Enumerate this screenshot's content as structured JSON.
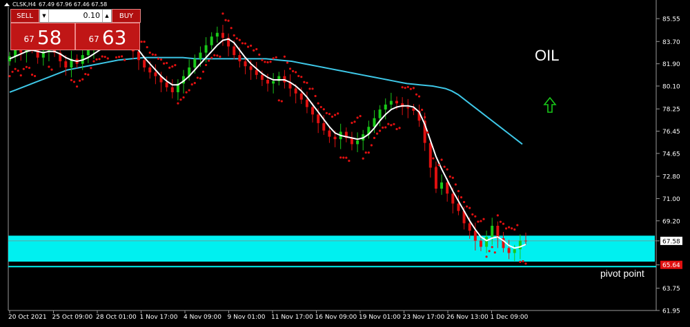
{
  "header": {
    "symbol": "CLSK,H4",
    "ohlc": "67.49 67.96 67.46 67.58"
  },
  "trade_panel": {
    "sell_label": "SELL",
    "buy_label": "BUY",
    "lot_value": "0.10",
    "sell_price_small": "67",
    "sell_price_big": "58",
    "buy_price_small": "67",
    "buy_price_big": "63"
  },
  "annotations": {
    "title": "OIL",
    "pivot_label": "pivot point",
    "arrow": "up-arrow-icon",
    "arrow_color": "#19c919"
  },
  "colors": {
    "background": "#000000",
    "bull": "#19c919",
    "bear": "#e01010",
    "sar": "#e01010",
    "ma_fast": "#ffffff",
    "ma_slow": "#3ec8e8",
    "zone": "#00f0f0",
    "current_price_tag": "#ffffff",
    "pivot_tag": "#e01010"
  },
  "chart_data": {
    "type": "candlestick",
    "timeframe": "H4",
    "ylim": [
      61.95,
      86.5
    ],
    "y_ticks": [
      "85.55",
      "83.70",
      "81.90",
      "80.10",
      "78.25",
      "76.45",
      "74.65",
      "72.80",
      "71.00",
      "69.20",
      "67.58",
      "65.64",
      "63.75",
      "61.95"
    ],
    "x_ticks": [
      "20 Oct 2021",
      "25 Oct 09:00",
      "28 Oct 01:00",
      "1 Nov 17:00",
      "4 Nov 09:00",
      "9 Nov 01:00",
      "11 Nov 17:00",
      "16 Nov 09:00",
      "19 Nov 01:00",
      "23 Nov 17:00",
      "26 Nov 13:00",
      "1 Dec 09:00"
    ],
    "current_price": 67.58,
    "pivot_price": 65.64,
    "zone": [
      65.9,
      68.0
    ],
    "zone_line": 65.5,
    "closes": [
      82.5,
      83.2,
      82.8,
      83.6,
      83.1,
      82.4,
      82.9,
      83.5,
      82.8,
      82.1,
      81.6,
      82.3,
      81.9,
      82.6,
      83.1,
      83.7,
      84.0,
      84.3,
      83.8,
      84.5,
      84.1,
      83.5,
      82.9,
      82.2,
      81.6,
      81.2,
      80.9,
      80.4,
      80.0,
      79.6,
      80.3,
      80.9,
      81.6,
      82.3,
      82.8,
      83.4,
      84.1,
      84.4,
      84.0,
      83.3,
      82.6,
      82.1,
      81.7,
      81.4,
      81.0,
      80.6,
      80.3,
      80.5,
      80.9,
      80.4,
      79.9,
      79.5,
      79.0,
      78.4,
      77.8,
      77.1,
      76.5,
      76.0,
      75.8,
      76.4,
      75.9,
      75.4,
      75.7,
      76.2,
      76.8,
      77.5,
      78.2,
      78.6,
      78.9,
      78.7,
      78.4,
      78.3,
      78.1,
      77.3,
      75.5,
      73.5,
      71.8,
      72.3,
      71.4,
      70.6,
      70.0,
      69.0,
      68.4,
      67.6,
      67.1,
      67.9,
      68.8,
      67.8,
      67.0,
      66.6,
      66.9,
      67.6,
      67.58
    ],
    "ma_fast": [
      82.3,
      82.5,
      82.7,
      82.9,
      83.0,
      82.9,
      82.8,
      82.9,
      82.9,
      82.7,
      82.4,
      82.2,
      82.1,
      82.2,
      82.4,
      82.7,
      83.0,
      83.3,
      83.6,
      83.9,
      84.0,
      83.9,
      83.5,
      83.0,
      82.4,
      81.9,
      81.4,
      80.9,
      80.5,
      80.2,
      80.2,
      80.5,
      80.9,
      81.4,
      81.9,
      82.4,
      82.9,
      83.4,
      83.8,
      83.9,
      83.6,
      83.0,
      82.4,
      81.9,
      81.5,
      81.1,
      80.8,
      80.6,
      80.6,
      80.6,
      80.4,
      80.1,
      79.7,
      79.2,
      78.6,
      78.0,
      77.4,
      76.8,
      76.3,
      76.1,
      76.0,
      75.9,
      75.8,
      75.9,
      76.2,
      76.7,
      77.3,
      77.8,
      78.2,
      78.4,
      78.5,
      78.5,
      78.4,
      78.0,
      77.0,
      75.7,
      74.4,
      73.4,
      72.5,
      71.6,
      70.8,
      70.0,
      69.2,
      68.5,
      67.9,
      67.6,
      67.8,
      67.9,
      67.6,
      67.2,
      67.0,
      67.1,
      67.3
    ],
    "ma_slow": [
      79.6,
      79.8,
      80.0,
      80.2,
      80.4,
      80.6,
      80.8,
      81.0,
      81.2,
      81.4,
      81.5,
      81.6,
      81.7,
      81.8,
      81.9,
      82.0,
      82.1,
      82.2,
      82.25,
      82.3,
      82.35,
      82.4,
      82.4,
      82.4,
      82.4,
      82.4,
      82.4,
      82.4,
      82.35,
      82.3,
      82.3,
      82.3,
      82.3,
      82.3,
      82.3,
      82.3,
      82.3,
      82.3,
      82.3,
      82.3,
      82.3,
      82.25,
      82.2,
      82.15,
      82.1,
      82.0,
      81.9,
      81.8,
      81.7,
      81.6,
      81.5,
      81.4,
      81.3,
      81.2,
      81.1,
      81.0,
      80.9,
      80.8,
      80.7,
      80.6,
      80.5,
      80.4,
      80.3,
      80.25,
      80.2,
      80.15,
      80.1,
      80.0,
      79.9,
      79.7,
      79.4,
      79.0,
      78.6,
      78.2,
      77.8,
      77.4,
      77.0,
      76.6,
      76.2,
      75.8,
      75.4
    ]
  }
}
